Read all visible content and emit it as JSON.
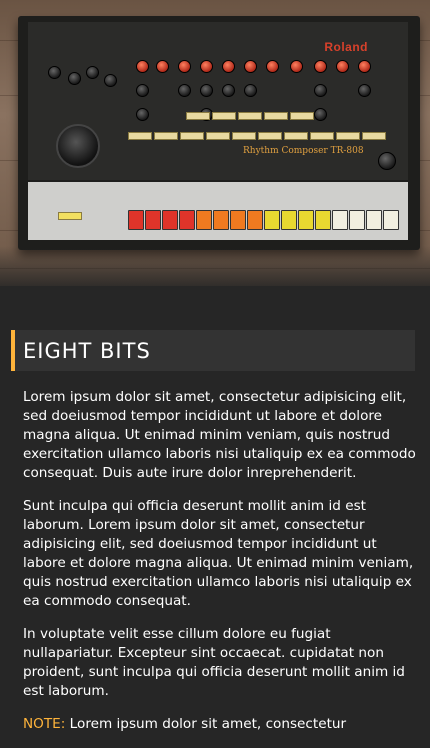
{
  "hero": {
    "image_name": "roland-tr-808-rhythm-composer",
    "brand_text": "Roland",
    "model_text": "Rhythm Composer TR-808"
  },
  "section": {
    "title": "EIGHT BITS"
  },
  "paragraphs": [
    "Lorem ipsum dolor sit amet, consectetur adipisicing elit, sed doeiusmod tempor incididunt ut labore et dolore magna aliqua. Ut enimad minim veniam, quis nostrud exercitation ullamco laboris nisi utaliquip ex ea commodo consequat. Duis aute irure dolor inreprehenderit.",
    "Sunt inculpa qui officia deserunt mollit anim id est laborum. Lorem ipsum dolor sit amet, consectetur adipisicing elit, sed doeiusmod tempor incididunt ut labore et dolore magna aliqua. Ut enimad minim veniam, quis nostrud exercitation ullamco laboris nisi utaliquip ex ea commodo consequat.",
    "In voluptate velit esse cillum dolore eu fugiat nullapariatur. Excepteur sint occaecat. cupidatat non proident, sunt inculpa qui officia deserunt mollit anim id est laborum."
  ],
  "note": {
    "label": "NOTE:",
    "text": " Lorem ipsum dolor sit amet, consectetur"
  },
  "colors": {
    "background": "#262626",
    "title_bar": "#333333",
    "accent": "#ffb43b",
    "text": "#ffffff"
  }
}
